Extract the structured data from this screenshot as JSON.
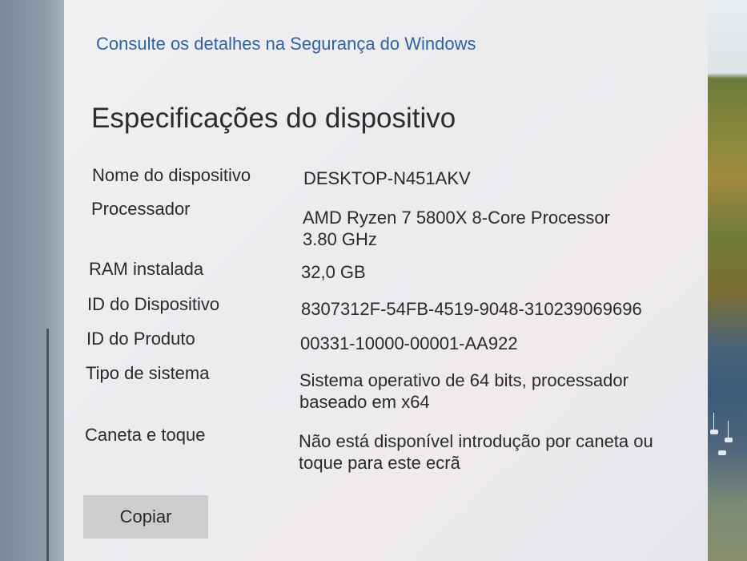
{
  "security_link": "Consulte os detalhes na Segurança do Windows",
  "section_title": "Especificações do dispositivo",
  "specs": [
    {
      "label": "Nome do dispositivo",
      "value": "DESKTOP-N451AKV"
    },
    {
      "label": "Processador",
      "value": "AMD Ryzen 7 5800X 8-Core Processor 3.80 GHz"
    },
    {
      "label": "RAM instalada",
      "value": "32,0 GB"
    },
    {
      "label": "ID do Dispositivo",
      "value": "8307312F-54FB-4519-9048-310239069696"
    },
    {
      "label": "ID do Produto",
      "value": "00331-10000-00001-AA922"
    },
    {
      "label": "Tipo de sistema",
      "value": "Sistema operativo de 64 bits, processador baseado em x64"
    },
    {
      "label": "Caneta e toque",
      "value": "Não está disponível introdução por caneta ou toque para este ecrã"
    }
  ],
  "copy_button": "Copiar",
  "colors": {
    "link": "#2f62a8",
    "text": "#2a2a2c",
    "window_bg": "#efeff1",
    "button_bg": "#cdcdd0"
  }
}
